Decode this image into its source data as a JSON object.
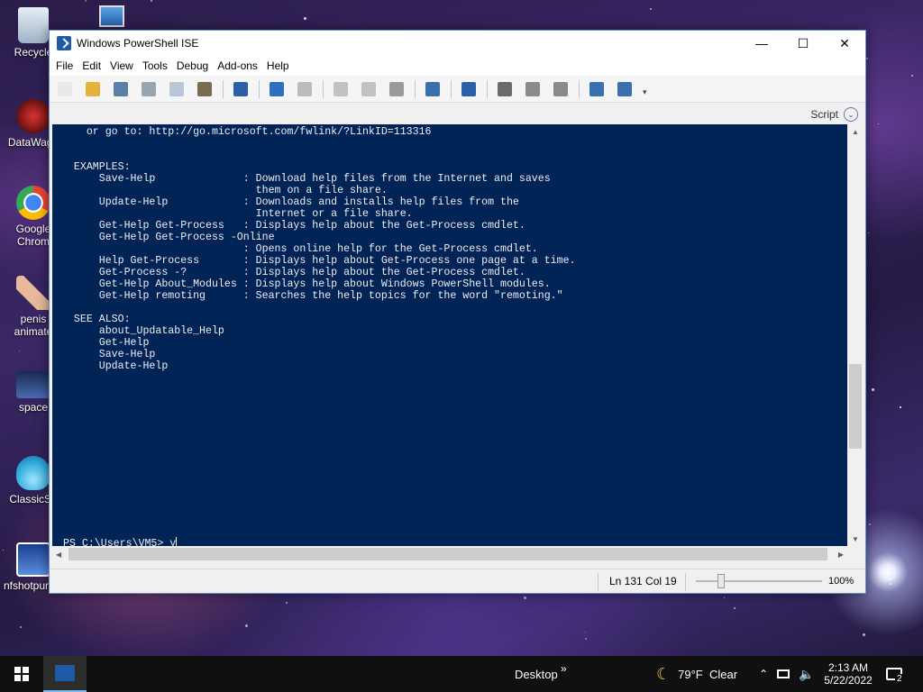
{
  "desktop": {
    "icons": [
      {
        "label": "Recycle",
        "icon": "recycle-bin-icon"
      },
      {
        "label": "DataWago",
        "icon": "app-shortcut-icon"
      },
      {
        "label": "Google Chrom",
        "icon": "chrome-icon"
      },
      {
        "label": "penis animate",
        "icon": "app-shortcut-icon"
      },
      {
        "label": "space",
        "icon": "image-file-icon"
      },
      {
        "label": "ClassicSh",
        "icon": "classic-shell-icon"
      },
      {
        "label": "nfshotpurs...",
        "icon": "app-shortcut-icon"
      }
    ]
  },
  "window": {
    "title": "Windows PowerShell ISE",
    "controls": {
      "minimize": "—",
      "maximize": "☐",
      "close": "✕"
    }
  },
  "menu": [
    "File",
    "Edit",
    "View",
    "Tools",
    "Debug",
    "Add-ons",
    "Help"
  ],
  "toolbar": {
    "buttons": [
      {
        "name": "new-file",
        "color": "#e9e9e9"
      },
      {
        "name": "open-folder",
        "color": "#e6b23c"
      },
      {
        "name": "save",
        "color": "#5b7fa8"
      },
      {
        "name": "cut",
        "color": "#9aa5b3"
      },
      {
        "name": "copy",
        "color": "#b8c6d8"
      },
      {
        "name": "paste",
        "color": "#7a6a52"
      },
      {
        "name": "powershell-run",
        "color": "#2b5fa9"
      },
      {
        "name": "undo",
        "color": "#2f6fc0"
      },
      {
        "name": "redo",
        "color": "#bcbcbc"
      },
      {
        "name": "run-script",
        "color": "#c2c2c2"
      },
      {
        "name": "run-selection",
        "color": "#c2c2c2"
      },
      {
        "name": "stop",
        "color": "#9a9a9a"
      },
      {
        "name": "remote-powershell",
        "color": "#3a6fb0"
      },
      {
        "name": "start-powershell",
        "color": "#2b5fa9"
      },
      {
        "name": "layout-top",
        "color": "#6a6a6a"
      },
      {
        "name": "layout-right",
        "color": "#8a8a8a"
      },
      {
        "name": "layout-max",
        "color": "#8a8a8a"
      },
      {
        "name": "show-commands",
        "color": "#3a6fb0"
      },
      {
        "name": "show-addon",
        "color": "#3a6fb0"
      }
    ]
  },
  "scriptbar": {
    "label": "Script"
  },
  "console": {
    "lines": [
      "    or go to: http://go.microsoft.com/fwlink/?LinkID=113316",
      "",
      "",
      "  EXAMPLES:",
      "      Save-Help              : Download help files from the Internet and saves",
      "                               them on a file share.",
      "      Update-Help            : Downloads and installs help files from the",
      "                               Internet or a file share.",
      "      Get-Help Get-Process   : Displays help about the Get-Process cmdlet.",
      "      Get-Help Get-Process -Online",
      "                             : Opens online help for the Get-Process cmdlet.",
      "      Help Get-Process       : Displays help about Get-Process one page at a time.",
      "      Get-Process -?         : Displays help about the Get-Process cmdlet.",
      "      Get-Help About_Modules : Displays help about Windows PowerShell modules.",
      "      Get-Help remoting      : Searches the help topics for the word \"remoting.\"",
      "",
      "  SEE ALSO:",
      "      about_Updatable_Help",
      "      Get-Help",
      "      Save-Help",
      "      Update-Help"
    ],
    "prompt": "PS C:\\Users\\VM5> y"
  },
  "status": {
    "position": "Ln 131  Col 19",
    "zoom": "100%",
    "zoom_level": 0.2
  },
  "taskbar": {
    "desktop_label": "Desktop",
    "chevron": "»",
    "weather": "79°F  Clear",
    "time": "2:13 AM",
    "date": "5/22/2022",
    "notifications": "2"
  }
}
